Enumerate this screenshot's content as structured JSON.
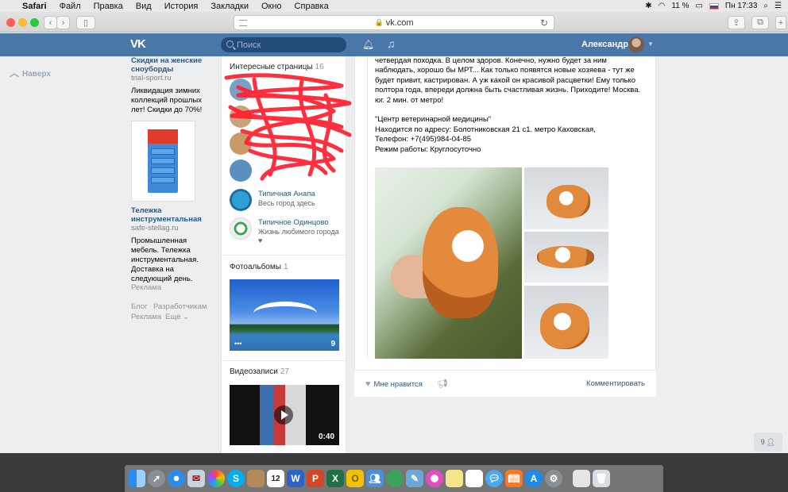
{
  "menubar": {
    "apple_glyph": "",
    "items": [
      "Safari",
      "Файл",
      "Правка",
      "Вид",
      "История",
      "Закладки",
      "Окно",
      "Справка"
    ],
    "battery": "11 %",
    "clock": "Пн 17:33"
  },
  "browser": {
    "url": "vk.com"
  },
  "vk": {
    "logo": "VK",
    "search_placeholder": "Поиск",
    "user_name": "Александр"
  },
  "left": {
    "back_to_top": "Наверх",
    "ad1": {
      "title": "Скидки на женские сноуборды",
      "domain": "trial-sport.ru",
      "text": "Ликвидация зимних коллекций прошлых лет! Скидки до 70%!"
    },
    "ad2": {
      "title": "Тележка инструментальная",
      "domain": "safe-stellag.ru",
      "text": "Промышленная мебель. Тележка инструментальная. Доставка на следующий день."
    },
    "ads_label": "Реклама",
    "footer": {
      "blog": "Блог",
      "developers": "Разработчикам",
      "ads": "Реклама",
      "more": "Ещё ⌄"
    }
  },
  "mid": {
    "pages_title": "Интересные страницы",
    "pages_count": "16",
    "pages": [
      {
        "name": "Типичная Анапа",
        "sub": "Весь город здесь"
      },
      {
        "name": "Типичное Одинцово",
        "sub": "Жизнь любимого города ♥"
      }
    ],
    "albums_title": "Фотоальбомы",
    "albums_count": "1",
    "album_photo_count": "9",
    "videos_title": "Видеозаписи",
    "videos_count": "27",
    "video_duration": "0:40"
  },
  "post": {
    "text": "четвердая походка. В целом здоров. Конечно, нужно будет за ним наблюдать, хорошо бы МРТ... Как только появятся новые хозяева - тут же будет привит, кастрирован. А уж какой он красивой расцветки! Ему только полтора года, впереди должна быть счастливая жизнь. Приходите! Москва. юг. 2 мин. от метро!\n\n\"Центр ветеринарной медицины\"\nНаходится по адресу: Болотниковская 21 с1. метро Каховская,\nТелефон: +7(495)984-04-85\nРежим работы: Круглосуточно",
    "like_label": "Мне нравится",
    "comment_label": "Комментировать"
  },
  "online_badge": "9",
  "dock": {
    "icons": [
      "finder-icon",
      "launchpad-icon",
      "safari-icon",
      "mail-icon",
      "photos-icon",
      "skype-icon",
      "contacts-icon",
      "calendar-icon",
      "word-icon",
      "powerpoint-icon",
      "excel-icon",
      "outlook-icon",
      "messenger-icon",
      "app-icon",
      "preview-icon",
      "itunes-icon",
      "notes-icon",
      "reminders-icon",
      "messages-icon",
      "books-icon",
      "appstore-icon",
      "settings-icon",
      "downloads-icon",
      "trash-icon"
    ],
    "calendar_day": "12"
  }
}
